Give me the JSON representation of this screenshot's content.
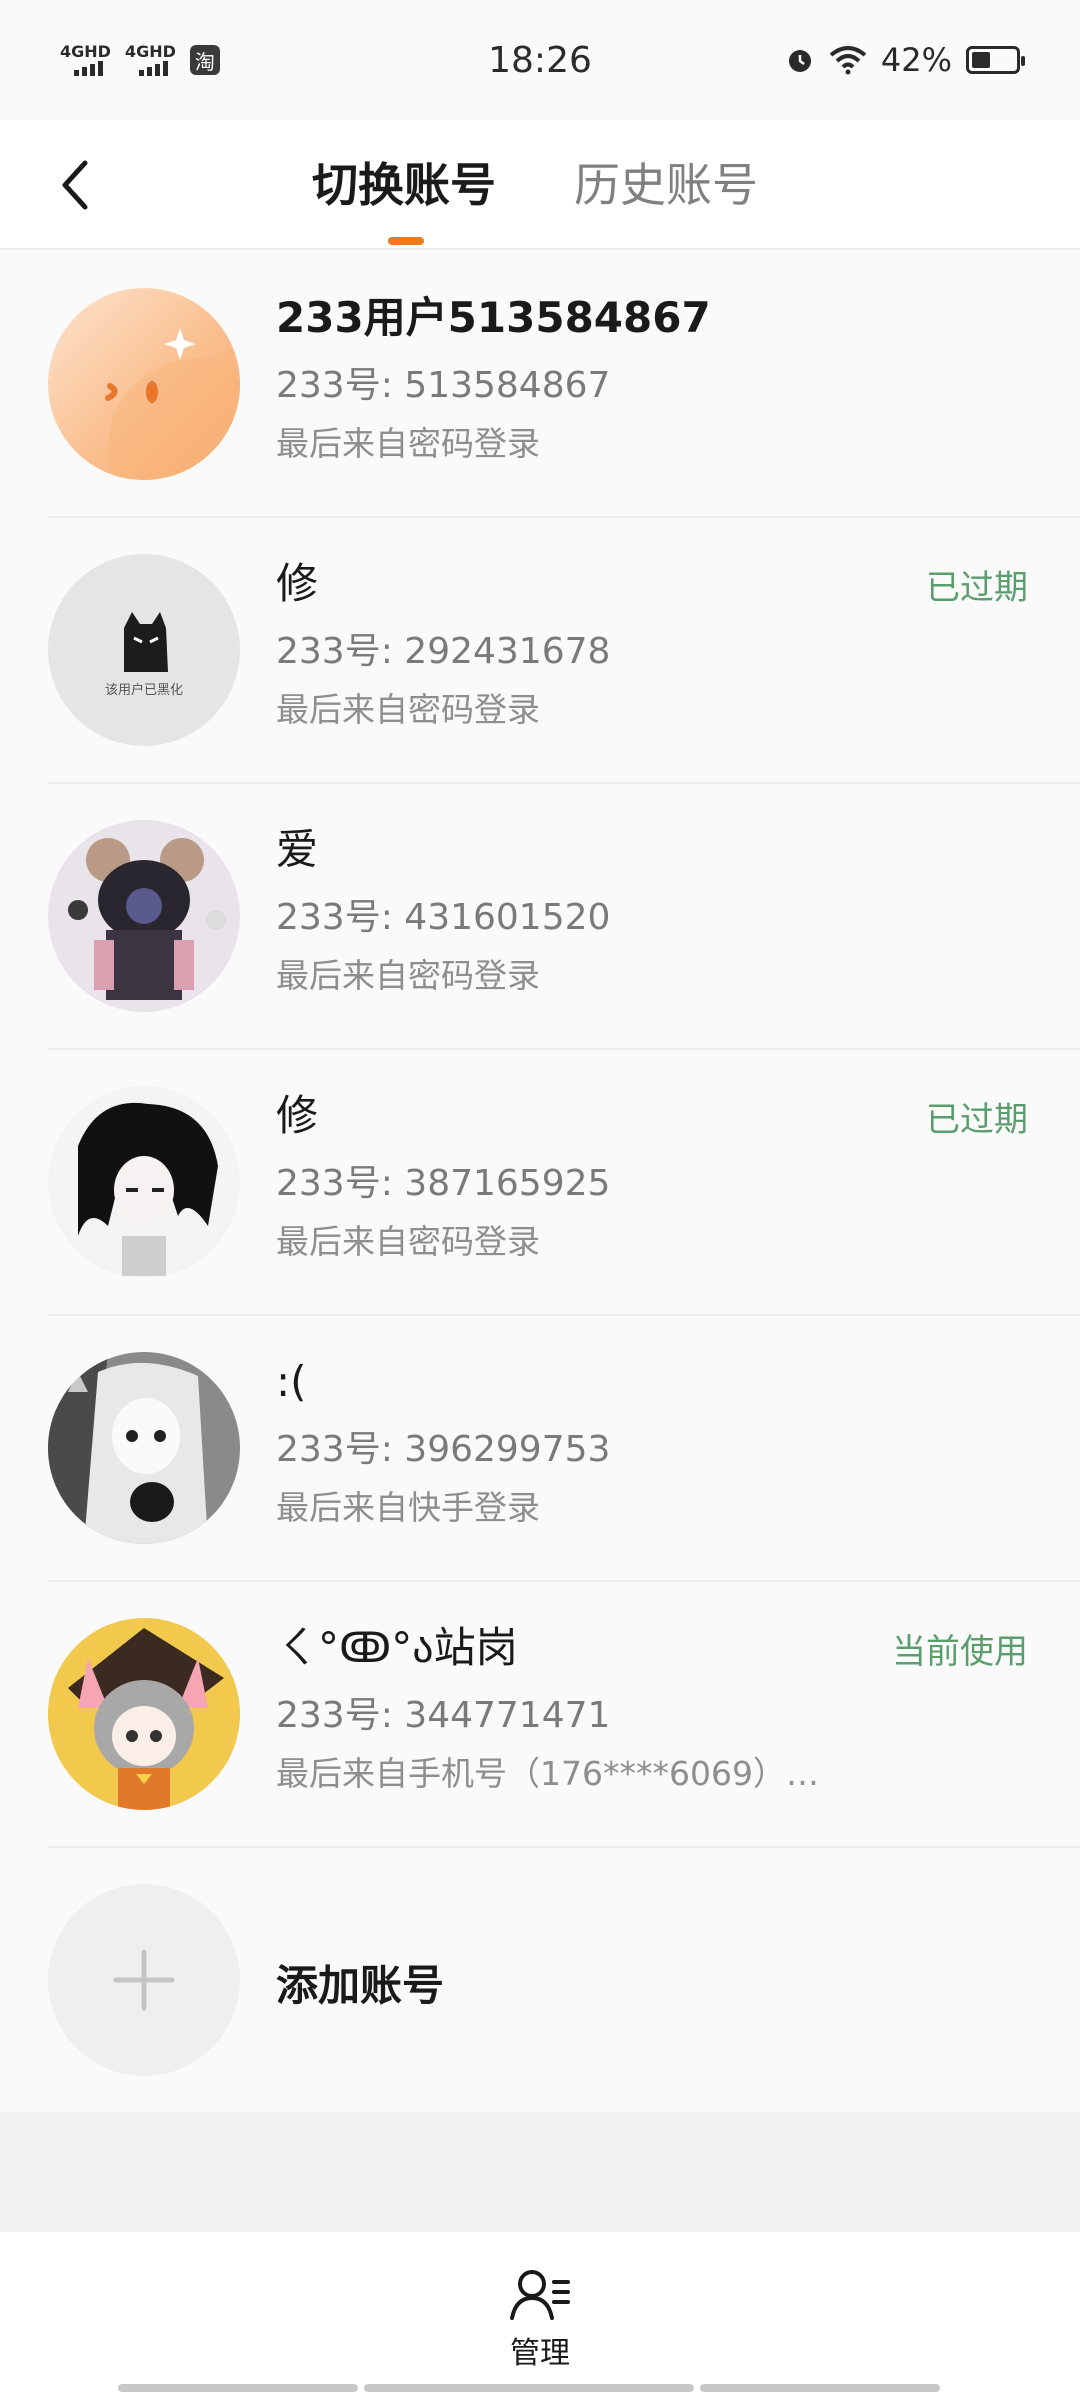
{
  "status_bar": {
    "signal1": "4GHD",
    "signal2": "4GHD",
    "app_badge": "淘",
    "time": "18:26",
    "battery": "42%",
    "battery_level": 0.42
  },
  "nav": {
    "tab_switch": "切换账号",
    "tab_history": "历史账号"
  },
  "accounts": [
    {
      "name": "233用户513584867",
      "uid": "233号: 513584867",
      "last": "最后来自密码登录",
      "status": "",
      "avatar": "orange-face"
    },
    {
      "name": "修",
      "uid": "233号: 292431678",
      "last": "最后来自密码登录",
      "status": "已过期",
      "avatar": "cat",
      "avatar_text": "该用户已黑化"
    },
    {
      "name": "爱",
      "uid": "233号: 431601520",
      "last": "最后来自密码登录",
      "status": "",
      "avatar": "anime-1"
    },
    {
      "name": "修",
      "uid": "233号: 387165925",
      "last": "最后来自密码登录",
      "status": "已过期",
      "avatar": "anime-2"
    },
    {
      "name": ":(",
      "uid": "233号: 396299753",
      "last": "最后来自快手登录",
      "status": "",
      "avatar": "anime-3"
    },
    {
      "name": "ㄑ°ↂ°ა站岗",
      "uid": "233号: 344771471",
      "last": "最后来自手机号（176****6069）…",
      "status": "当前使用",
      "avatar": "anime-4"
    }
  ],
  "add_account": "添加账号",
  "bottom": {
    "manage": "管理"
  },
  "colors": {
    "accent": "#f07a1e",
    "status_green": "#5a9e6e"
  }
}
